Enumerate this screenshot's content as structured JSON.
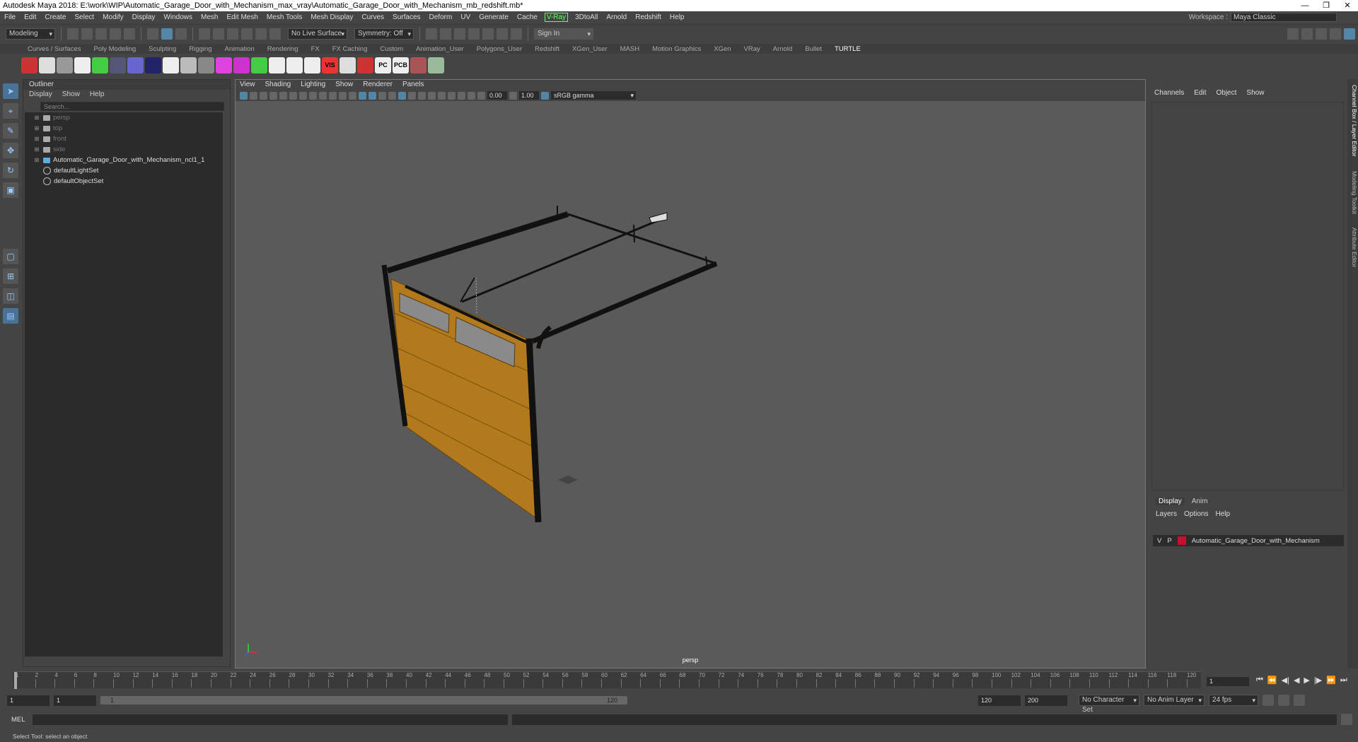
{
  "window": {
    "title": "Autodesk Maya 2018: E:\\work\\WIP\\Automatic_Garage_Door_with_Mechanism_max_vray\\Automatic_Garage_Door_with_Mechanism_mb_redshift.mb*",
    "controls": [
      "—",
      "❐",
      "✕"
    ]
  },
  "menubar": [
    "File",
    "Edit",
    "Create",
    "Select",
    "Modify",
    "Display",
    "Windows",
    "Mesh",
    "Edit Mesh",
    "Mesh Tools",
    "Mesh Display",
    "Curves",
    "Surfaces",
    "Deform",
    "UV",
    "Generate",
    "Cache",
    "V-Ray",
    "3DtoAll",
    "Arnold",
    "Redshift",
    "Help"
  ],
  "workspace": {
    "label": "Workspace :",
    "value": "Maya Classic"
  },
  "statusline": {
    "mode": "Modeling",
    "live_surface": "No Live Surface",
    "symmetry": "Symmetry: Off",
    "sign_in": "Sign In"
  },
  "shelf_tabs": [
    "Curves / Surfaces",
    "Poly Modeling",
    "Sculpting",
    "Rigging",
    "Animation",
    "Rendering",
    "FX",
    "FX Caching",
    "Custom",
    "Animation_User",
    "Polygons_User",
    "Redshift",
    "XGen_User",
    "MASH",
    "Motion Graphics",
    "XGen",
    "VRay",
    "Arnold",
    "Bullet",
    "TURTLE"
  ],
  "shelf_active": "TURTLE",
  "shelf_icon_colors": [
    "#c33",
    "#ddd",
    "#999",
    "#eee",
    "#4c4",
    "#557",
    "#66c",
    "#226",
    "#eee",
    "#bbb",
    "#888",
    "#d4d",
    "#c3c",
    "#4c4",
    "#eee",
    "#eee",
    "#eee",
    "#e33",
    "#ddd",
    "#c33",
    "#eee",
    "#eee",
    "#a55",
    "#9b9"
  ],
  "shelf_icon_text": {
    "vis": "VIS",
    "pc": "PC",
    "pcb": "PCB"
  },
  "outliner": {
    "title": "Outliner",
    "menus": [
      "Display",
      "Show",
      "Help"
    ],
    "search_placeholder": "Search...",
    "items": [
      {
        "label": "persp",
        "dim": true,
        "type": "camera"
      },
      {
        "label": "top",
        "dim": true,
        "type": "camera"
      },
      {
        "label": "front",
        "dim": true,
        "type": "camera"
      },
      {
        "label": "side",
        "dim": true,
        "type": "camera"
      },
      {
        "label": "Automatic_Garage_Door_with_Mechanism_ncl1_1",
        "dim": false,
        "type": "group"
      },
      {
        "label": "defaultLightSet",
        "dim": false,
        "type": "set"
      },
      {
        "label": "defaultObjectSet",
        "dim": false,
        "type": "set"
      }
    ]
  },
  "viewport": {
    "menus": [
      "View",
      "Shading",
      "Lighting",
      "Show",
      "Renderer",
      "Panels"
    ],
    "field1": "0.00",
    "field2": "1.00",
    "color_space": "sRGB gamma",
    "camera": "persp"
  },
  "channelbox": {
    "menus": [
      "Channels",
      "Edit",
      "Object",
      "Show"
    ]
  },
  "layers": {
    "tabs": [
      "Display",
      "Anim"
    ],
    "menus": [
      "Layers",
      "Options",
      "Help"
    ],
    "row": {
      "v": "V",
      "p": "P",
      "color": "#c8102e",
      "name": "Automatic_Garage_Door_with_Mechanism"
    }
  },
  "side_tabs": [
    "Channel Box / Layer Editor",
    "Modeling Toolkit",
    "Attribute Editor"
  ],
  "timeline": {
    "ticks": [
      "1",
      "2",
      "4",
      "6",
      "8",
      "10",
      "12",
      "14",
      "16",
      "18",
      "20",
      "22",
      "24",
      "26",
      "28",
      "30",
      "32",
      "34",
      "36",
      "38",
      "40",
      "42",
      "44",
      "46",
      "48",
      "50",
      "52",
      "54",
      "56",
      "58",
      "60",
      "62",
      "64",
      "66",
      "68",
      "70",
      "72",
      "74",
      "76",
      "78",
      "80",
      "82",
      "84",
      "86",
      "88",
      "90",
      "92",
      "94",
      "96",
      "98",
      "100",
      "102",
      "104",
      "106",
      "108",
      "110",
      "112",
      "114",
      "116",
      "118",
      "120"
    ],
    "current": "1",
    "controls": [
      "⏮",
      "⏪",
      "◀|",
      "◀",
      "▶",
      "|▶",
      "⏩",
      "⏭"
    ]
  },
  "range": {
    "start": "1",
    "start2": "1",
    "slider_start": "1",
    "slider_end": "120",
    "end": "120",
    "end2": "200",
    "character_set": "No Character Set",
    "anim_layer": "No Anim Layer",
    "fps": "24 fps"
  },
  "mel": {
    "label": "MEL"
  },
  "help_line": "Select Tool: select an object"
}
